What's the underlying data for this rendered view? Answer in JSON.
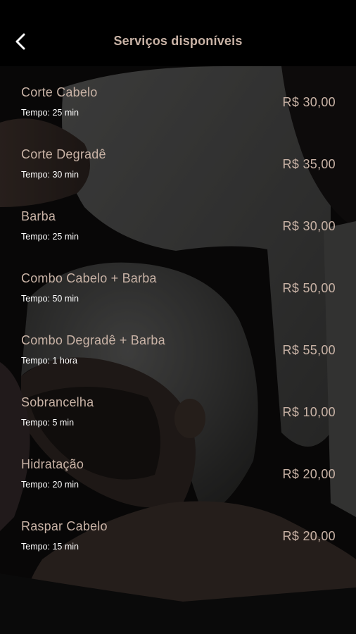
{
  "header": {
    "title": "Serviços disponíveis",
    "back_icon": "chevron-left-icon"
  },
  "colors": {
    "accent_text": "#c9b3a6",
    "header_bg": "#000000",
    "secondary_text": "#ffffff"
  },
  "services": [
    {
      "name": "Corte Cabelo",
      "time": "Tempo: 25 min",
      "price": "R$ 30,00"
    },
    {
      "name": "Corte Degradê",
      "time": "Tempo: 30 min",
      "price": "R$ 35,00"
    },
    {
      "name": "Barba",
      "time": "Tempo: 25 min",
      "price": "R$ 30,00"
    },
    {
      "name": "Combo Cabelo + Barba",
      "time": "Tempo: 50 min",
      "price": "R$ 50,00"
    },
    {
      "name": "Combo Degradê + Barba",
      "time": "Tempo: 1 hora",
      "price": "R$ 55,00"
    },
    {
      "name": "Sobrancelha",
      "time": "Tempo: 5 min",
      "price": "R$ 10,00"
    },
    {
      "name": "Hidratação",
      "time": "Tempo: 20 min",
      "price": "R$ 20,00"
    },
    {
      "name": "Raspar Cabelo",
      "time": "Tempo: 15 min",
      "price": "R$ 20,00"
    }
  ]
}
